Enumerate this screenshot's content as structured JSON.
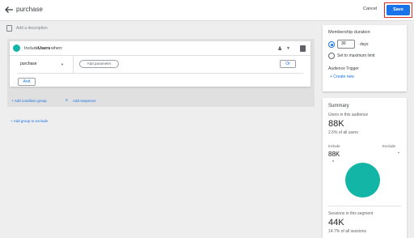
{
  "header": {
    "title": "purchase",
    "cancel_label": "Cancel",
    "save_label": "Save"
  },
  "description": {
    "placeholder": "Add a description"
  },
  "condition_group": {
    "include_prefix": "Include",
    "include_scope": "Users",
    "include_suffix": "when:",
    "event_name": "purchase",
    "add_parameter_label": "Add parameter",
    "or_label": "Or",
    "and_label": "And",
    "add_condition_group_label": "+ Add condition group",
    "add_sequence_label": "Add sequence"
  },
  "add_group_to_exclude_label": "+ Add group to exclude",
  "membership": {
    "title": "Membership duration",
    "days_value": "30",
    "days_unit": "days",
    "set_max_label": "Set to maximum limit",
    "trigger_title": "Audience Trigger",
    "create_new_label": "+ Create new",
    "selected_option": "days"
  },
  "summary": {
    "title": "Summary",
    "users_label": "Users in this audience",
    "users_value": "88K",
    "users_pct": "2.6% of all users",
    "include_label": "Include",
    "exclude_label": "Exclude",
    "include_value": "88K",
    "exclude_value": "-",
    "sessions_label": "Sessions in this segment",
    "sessions_value": "44K",
    "sessions_pct": "14.7% of all sessions"
  },
  "colors": {
    "accent": "#1a73e8",
    "teal": "#12b5a6",
    "highlight": "#d93025"
  },
  "icons": [
    "back-arrow-icon",
    "description-icon",
    "users-icon",
    "chevron-down-icon",
    "trash-icon",
    "sequence-icon"
  ]
}
